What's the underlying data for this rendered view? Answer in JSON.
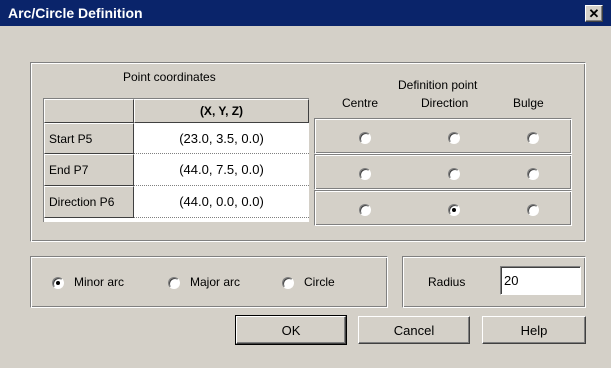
{
  "window": {
    "title": "Arc/Circle Definition",
    "close_glyph": "✕"
  },
  "point_coordinates": {
    "label": "Point coordinates",
    "column_header": "(X, Y, Z)",
    "rows": [
      {
        "name": "Start P5",
        "value": "(23.0, 3.5, 0.0)"
      },
      {
        "name": "End P7",
        "value": "(44.0, 7.5, 0.0)"
      },
      {
        "name": "Direction P6",
        "value": "(44.0, 0.0, 0.0)"
      }
    ]
  },
  "definition_point": {
    "label": "Definition point",
    "columns": [
      "Centre",
      "Direction",
      "Bulge"
    ],
    "selected": [
      [
        false,
        false,
        false
      ],
      [
        false,
        false,
        false
      ],
      [
        false,
        true,
        false
      ]
    ]
  },
  "arc_type": {
    "options": [
      "Minor arc",
      "Major arc",
      "Circle"
    ],
    "selected": "Minor arc"
  },
  "radius": {
    "label": "Radius",
    "value": "20"
  },
  "buttons": {
    "ok": "OK",
    "cancel": "Cancel",
    "help": "Help"
  }
}
